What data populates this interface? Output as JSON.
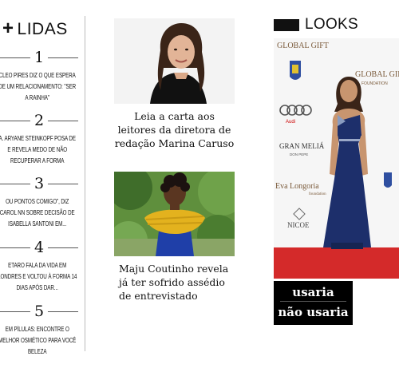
{
  "most_read": {
    "plus": "+",
    "title": "LIDAS",
    "items": [
      {
        "rank": "1",
        "text": "CLEO PIRES DIZ O QUE ESPERA DE UM RELACIONAMENTO: \"SER A RAINHA\""
      },
      {
        "rank": "2",
        "text": "A. ARYANE STEINKOPF POSA DE E REVELA MEDO DE NÃO RECUPERAR A FORMA"
      },
      {
        "rank": "3",
        "text": "OU PONTOS COMIGO\", DIZ CAROL NN SOBRE DECISÃO DE ISABELLA SANTONI EM..."
      },
      {
        "rank": "4",
        "text": "ETARO FALA DA VIDA EM LONDRES E VOLTOU À FORMA 14 DIAS APÓS DAR..."
      },
      {
        "rank": "5",
        "text": "EM PÍLULAS: ENCONTRE O MELHOR OSMÉTICO PARA VOCÊ BELEZA"
      }
    ]
  },
  "articles": [
    {
      "caption": "Leia a carta aos leitores da diretora de redação Marina Caruso"
    },
    {
      "caption": "Maju Coutinho revela já ter sofrido assédio de entrevistado"
    }
  ],
  "looks": {
    "title": "LOOKS",
    "vote_yes": "usaria",
    "vote_no": "não usaria",
    "backdrop": {
      "global_gift": "GLOBAL GIFT",
      "foundation": "FOUNDATION",
      "gran_melia_1": "GRAN MELIÁ",
      "gran_melia_2": "DON PEPE",
      "eva_longoria": "Eva Longoria",
      "foundation2": "foundation",
      "nicoe": "NICOE",
      "audi": "Audi"
    }
  },
  "colors": {
    "accent": "#000000",
    "divider": "#bbbbbb",
    "carpet": "#d42a2a",
    "dress": "#1d2f6b"
  }
}
